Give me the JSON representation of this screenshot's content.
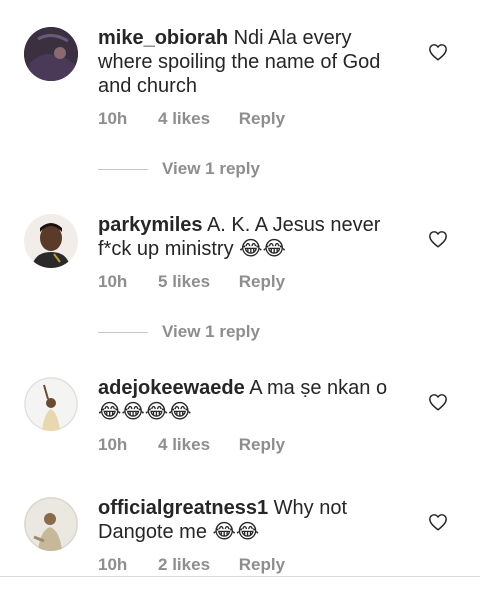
{
  "comments": [
    {
      "username": "mike_obiorah",
      "text": "Ndi Ala every where spoiling the name of God and church",
      "time": "10h",
      "likes": "4 likes",
      "reply": "Reply",
      "view_replies": "View 1 reply"
    },
    {
      "username": "parkymiles",
      "text": "A. K. A Jesus never f*ck up ministry 😂😂",
      "time": "10h",
      "likes": "5 likes",
      "reply": "Reply",
      "view_replies": "View 1 reply"
    },
    {
      "username": "adejokeewaede",
      "text": "A ma ṣe nkan o 😂😂😂😂",
      "time": "10h",
      "likes": "4 likes",
      "reply": "Reply"
    },
    {
      "username": "officialgreatness1",
      "text": "Why not Dangote me 😂😂",
      "time": "10h",
      "likes": "2 likes",
      "reply": "Reply"
    }
  ],
  "icons": {
    "like": "heart-outline-icon"
  },
  "colors": {
    "text": "#262626",
    "secondary": "#8e8e8e",
    "divider": "#dbdbdb"
  }
}
